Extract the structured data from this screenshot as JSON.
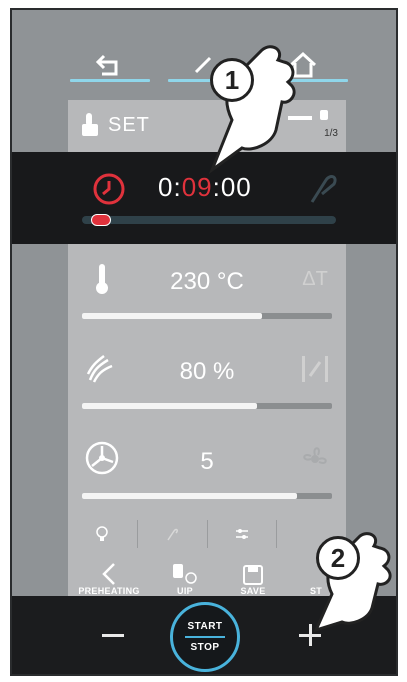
{
  "nav": {
    "back_icon": "back-arrow-icon",
    "middle_icon": "edit-icon",
    "home_icon": "home-icon"
  },
  "header": {
    "label": "SET",
    "page": "1/3"
  },
  "timer": {
    "h": "0:",
    "m": "09",
    "s": ":00",
    "progress": 0.04
  },
  "params": [
    {
      "id": "temperature",
      "value": "230 °C",
      "fill": 0.72,
      "icon": "thermometer-icon",
      "side": "delta-t",
      "side_text": "ΔT"
    },
    {
      "id": "humidity",
      "value": "80 %",
      "fill": 0.7,
      "icon": "steam-icon",
      "side": "damper"
    },
    {
      "id": "fan",
      "value": "5",
      "fill": 0.86,
      "icon": "fan-icon",
      "side": "fan-option"
    }
  ],
  "actions": [
    {
      "label": "PREHEATING"
    },
    {
      "label": "UIP"
    },
    {
      "label": "SAVE"
    },
    {
      "label": "ST"
    }
  ],
  "start_stop": {
    "top": "START",
    "bottom": "STOP"
  },
  "annotations": {
    "one": "1",
    "two": "2"
  },
  "colors": {
    "accent": "#49b3dc",
    "alert": "#e0323c",
    "dark": "#18191b"
  }
}
